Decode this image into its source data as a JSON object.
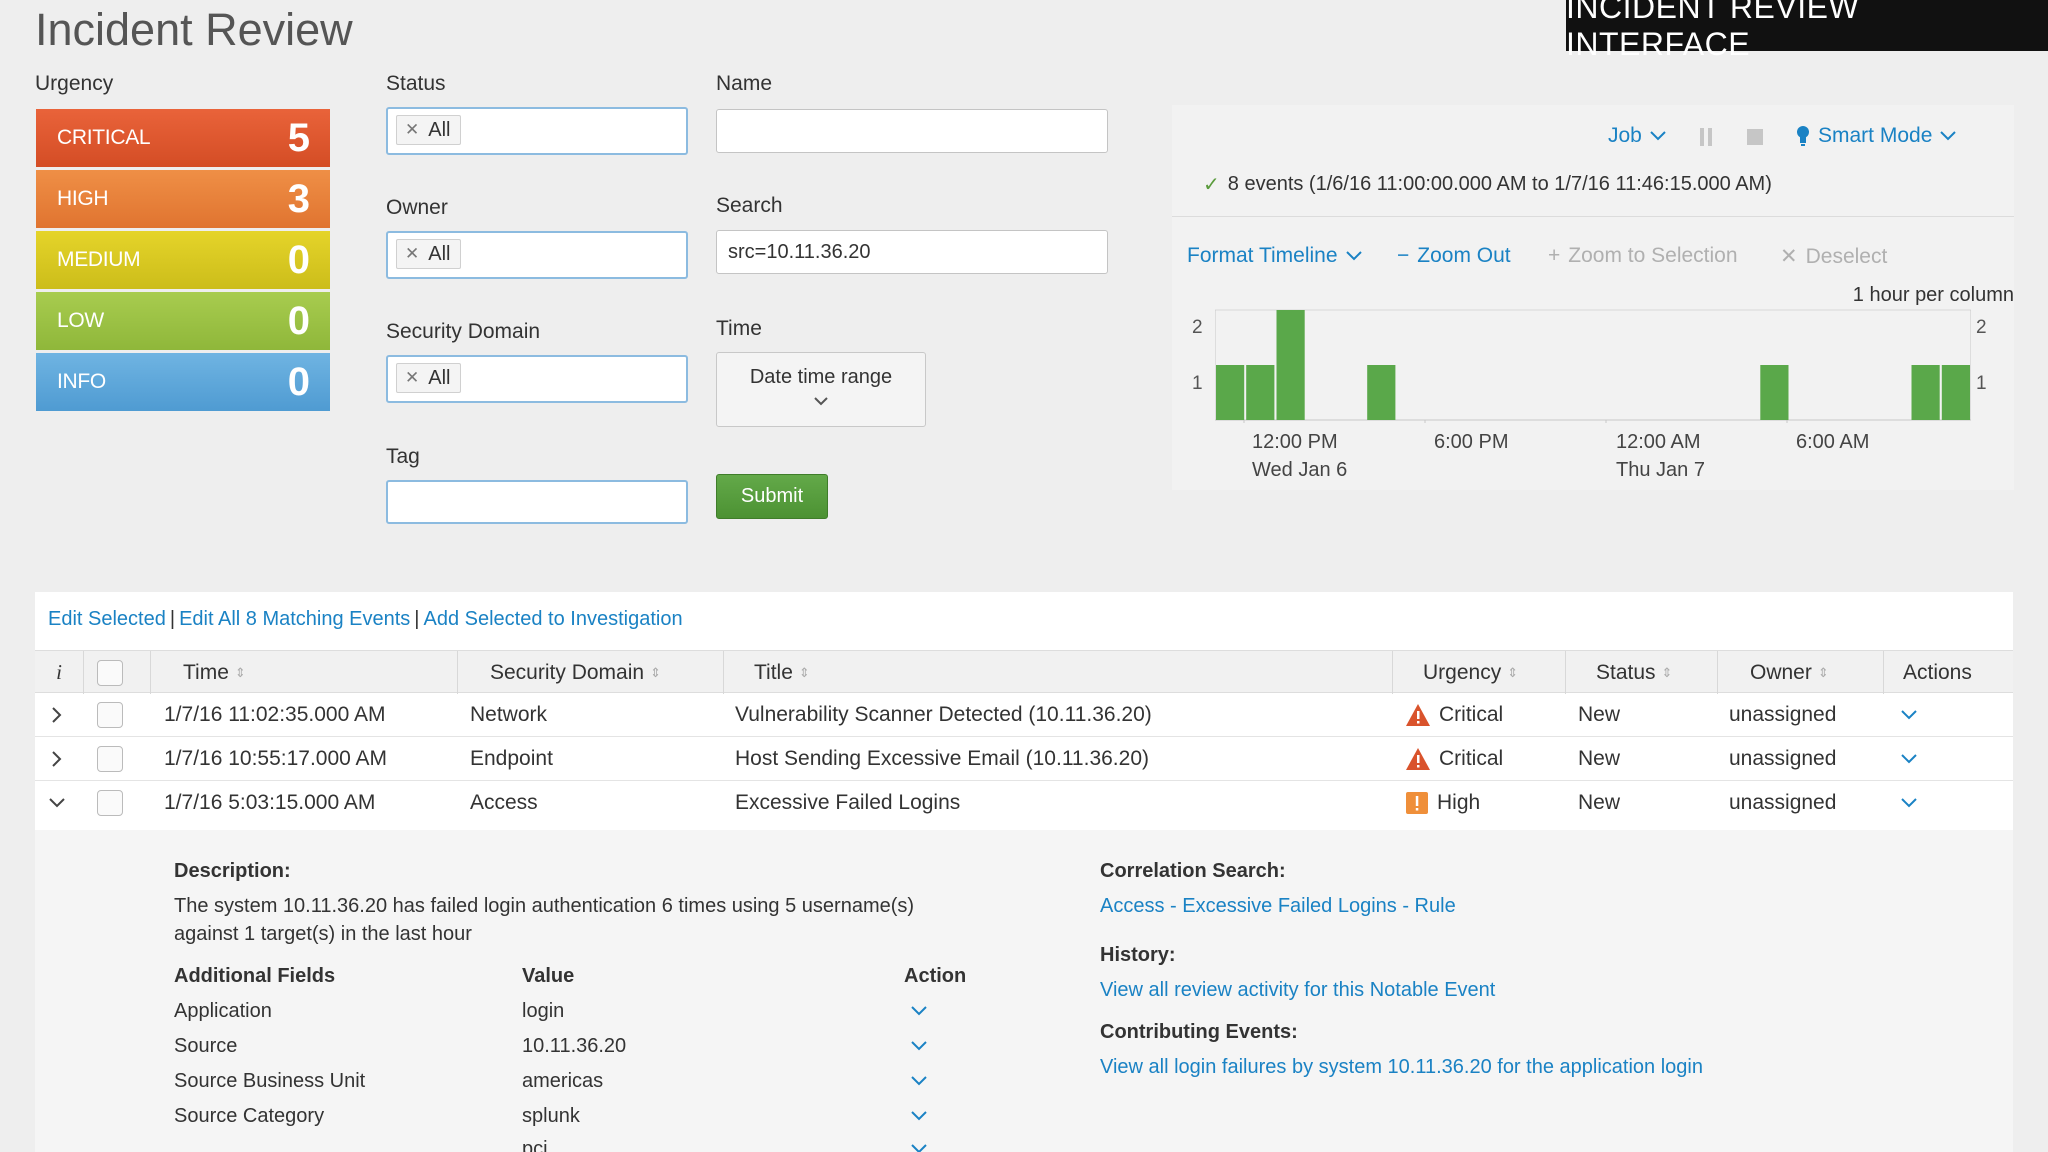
{
  "page": {
    "title": "Incident Review",
    "banner": "INCIDENT REVIEW INTERFACE"
  },
  "urgency": {
    "label": "Urgency",
    "tiles": [
      {
        "name": "CRITICAL",
        "count": "5",
        "color": "#e05a30"
      },
      {
        "name": "HIGH",
        "count": "3",
        "color": "#ea843d"
      },
      {
        "name": "MEDIUM",
        "count": "0",
        "color": "#dccb22"
      },
      {
        "name": "LOW",
        "count": "0",
        "color": "#9cc245"
      },
      {
        "name": "INFO",
        "count": "0",
        "color": "#5ea8db"
      }
    ]
  },
  "filters": {
    "status": {
      "label": "Status",
      "token": "All"
    },
    "owner": {
      "label": "Owner",
      "token": "All"
    },
    "security_domain": {
      "label": "Security Domain",
      "token": "All"
    },
    "tag": {
      "label": "Tag",
      "value": ""
    },
    "name": {
      "label": "Name",
      "value": ""
    },
    "search": {
      "label": "Search",
      "value": "src=10.11.36.20"
    },
    "time": {
      "label": "Time",
      "value": "Date time range"
    },
    "submit_label": "Submit"
  },
  "timeline": {
    "job_label": "Job",
    "smart_mode_label": "Smart Mode",
    "events_summary": "8 events (1/6/16 11:00:00.000 AM to 1/7/16 11:46:15.000 AM)",
    "format_label": "Format Timeline",
    "zoom_out_label": "Zoom Out",
    "zoom_selection_label": "Zoom to Selection",
    "deselect_label": "Deselect",
    "scale_label": "1 hour per column",
    "y_left": [
      "2",
      "1"
    ],
    "y_right": [
      "2",
      "1"
    ],
    "ticks": [
      {
        "line1": "12:00 PM",
        "line2": "Wed Jan 6"
      },
      {
        "line1": "6:00 PM",
        "line2": ""
      },
      {
        "line1": "12:00 AM",
        "line2": "Thu Jan 7"
      },
      {
        "line1": "6:00 AM",
        "line2": ""
      }
    ],
    "bar_color": "#5aa84a",
    "chart_data": {
      "type": "bar",
      "x_unit": "hour",
      "hours": [
        "1/6/16 11:00 AM",
        "1/6/16 12:00 PM",
        "1/6/16 1:00 PM",
        "1/6/16 4:00 PM",
        "1/7/16 5:00 AM",
        "1/7/16 10:00 AM",
        "1/7/16 11:00 AM"
      ],
      "values": [
        1,
        1,
        2,
        1,
        1,
        1,
        1
      ],
      "ylim": [
        0,
        2
      ]
    }
  },
  "table": {
    "actions": {
      "edit_selected": "Edit Selected",
      "edit_all": "Edit All 8 Matching Events",
      "add_investigation": "Add Selected to Investigation",
      "separator": "|"
    },
    "columns": {
      "info": "i",
      "time": "Time",
      "domain": "Security Domain",
      "title": "Title",
      "urgency": "Urgency",
      "status": "Status",
      "owner": "Owner",
      "actions": "Actions"
    },
    "rows": [
      {
        "time": "1/7/16 11:02:35.000 AM",
        "domain": "Network",
        "title": "Vulnerability Scanner Detected (10.11.36.20)",
        "urgency": "Critical",
        "urgency_icon": "warning-triangle-icon",
        "status": "New",
        "owner": "unassigned",
        "expanded": false
      },
      {
        "time": "1/7/16 10:55:17.000 AM",
        "domain": "Endpoint",
        "title": "Host Sending Excessive Email (10.11.36.20)",
        "urgency": "Critical",
        "urgency_icon": "warning-triangle-icon",
        "status": "New",
        "owner": "unassigned",
        "expanded": false
      },
      {
        "time": "1/7/16 5:03:15.000 AM",
        "domain": "Access",
        "title": "Excessive Failed Logins",
        "urgency": "High",
        "urgency_icon": "exclamation-square-icon",
        "status": "New",
        "owner": "unassigned",
        "expanded": true
      }
    ]
  },
  "details": {
    "description_label": "Description:",
    "description_line1": "The system 10.11.36.20 has failed login authentication 6 times using 5 username(s)",
    "description_line2": "against 1 target(s) in the last hour",
    "fields_header": {
      "field": "Additional Fields",
      "value": "Value",
      "action": "Action"
    },
    "fields": [
      {
        "field": "Application",
        "value": "login"
      },
      {
        "field": "Source",
        "value": "10.11.36.20"
      },
      {
        "field": "Source Business Unit",
        "value": "americas"
      },
      {
        "field": "Source Category",
        "value": "splunk"
      },
      {
        "field": "",
        "value": "pci"
      }
    ],
    "correlation_label": "Correlation Search:",
    "correlation_link": "Access - Excessive Failed Logins - Rule",
    "history_label": "History:",
    "history_link": "View all review activity for this Notable Event",
    "contributing_label": "Contributing Events:",
    "contributing_link": "View all login failures by system 10.11.36.20 for the application login"
  }
}
